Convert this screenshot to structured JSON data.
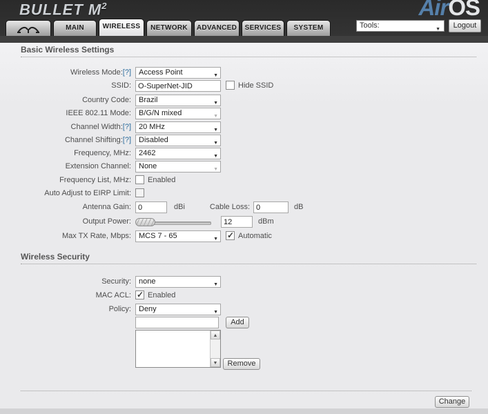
{
  "header": {
    "device_logo": "BULLET M",
    "device_logo_sup": "2",
    "brand_air": "Air",
    "brand_os": "OS",
    "tools_label": "Tools:",
    "logout_label": "Logout"
  },
  "tabs": {
    "icon_tab": {
      "icon": "ubiquiti-antenna-icon"
    },
    "items": [
      {
        "label": "MAIN",
        "active": false
      },
      {
        "label": "WIRELESS",
        "active": true
      },
      {
        "label": "NETWORK",
        "active": false
      },
      {
        "label": "ADVANCED",
        "active": false
      },
      {
        "label": "SERVICES",
        "active": false
      },
      {
        "label": "SYSTEM",
        "active": false
      }
    ]
  },
  "basic_wireless": {
    "title": "Basic Wireless Settings",
    "wireless_mode": {
      "label": "Wireless Mode:",
      "help": "[?]",
      "value": "Access Point"
    },
    "ssid": {
      "label": "SSID:",
      "value": "O-SuperNet-JID"
    },
    "hide_ssid": {
      "label": "Hide SSID",
      "checked": false
    },
    "country_code": {
      "label": "Country Code:",
      "value": "Brazil"
    },
    "ieee_mode": {
      "label": "IEEE 802.11 Mode:",
      "value": "B/G/N mixed",
      "disabled": true
    },
    "channel_width": {
      "label": "Channel Width:",
      "help": "[?]",
      "value": "20 MHz"
    },
    "channel_shifting": {
      "label": "Channel Shifting:",
      "help": "[?]",
      "value": "Disabled"
    },
    "frequency": {
      "label": "Frequency, MHz:",
      "value": "2462"
    },
    "extension_channel": {
      "label": "Extension Channel:",
      "value": "None",
      "disabled": true
    },
    "frequency_list": {
      "label": "Frequency List, MHz:",
      "checkbox_label": "Enabled",
      "checked": false
    },
    "eirp_limit": {
      "label": "Auto Adjust to EIRP Limit:",
      "checked": false
    },
    "antenna_gain": {
      "label": "Antenna Gain:",
      "value": "0",
      "unit": "dBi"
    },
    "cable_loss": {
      "label": "Cable Loss:",
      "value": "0",
      "unit": "dB"
    },
    "output_power": {
      "label": "Output Power:",
      "value": "12",
      "unit": "dBm"
    },
    "max_tx_rate": {
      "label": "Max TX Rate, Mbps:",
      "value": "MCS 7 - 65",
      "checkbox_label": "Automatic",
      "checked": true
    }
  },
  "wireless_security": {
    "title": "Wireless Security",
    "security": {
      "label": "Security:",
      "value": "none"
    },
    "mac_acl": {
      "label": "MAC ACL:",
      "checkbox_label": "Enabled",
      "checked": true
    },
    "policy": {
      "label": "Policy:",
      "value": "Deny"
    },
    "mac_entry": {
      "value": "",
      "add_label": "Add"
    },
    "mac_list": {
      "items": [],
      "remove_label": "Remove"
    }
  },
  "footer": {
    "change_label": "Change"
  },
  "colors": {
    "help_link": "#2e6e9e",
    "header_bg": "#2a2a2a",
    "brand_blue": "#5580aa"
  }
}
